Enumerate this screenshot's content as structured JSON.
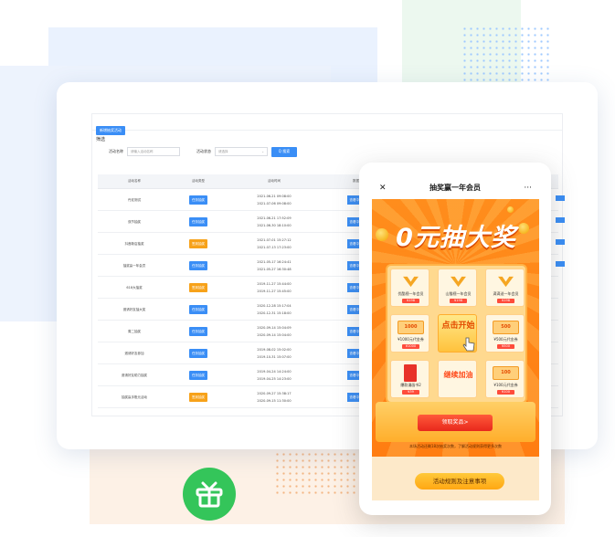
{
  "admin": {
    "create_button": "新增抽奖活动",
    "filter_title": "筛选",
    "filter_name_label": "活动名称",
    "filter_name_placeholder": "请输入活动名称",
    "filter_status_label": "活动状态",
    "filter_status_value": "请选择",
    "search_button": "Q 搜索",
    "columns": [
      "活动名称",
      "活动类型",
      "活动时间",
      "数据统计"
    ],
    "rows": [
      {
        "name": "丹尼测试",
        "type": "任务抽奖",
        "type_color": "blue",
        "start": "2021-06-21 09:08:00",
        "end": "2021-07-06 09:08:00",
        "action": "查看中奖记录"
      },
      {
        "name": "双节抽奖",
        "type": "任务抽奖",
        "type_color": "blue",
        "start": "2021-06-21 17:52:09",
        "end": "2021-06-30 18:10:00",
        "action": "查看中奖记录"
      },
      {
        "name": "抖音新店抽奖",
        "type": "签到抽奖",
        "type_color": "orange",
        "start": "2021-07-01 15:27:12",
        "end": "2021-07-13 17:23:00",
        "action": "查看中奖记录"
      },
      {
        "name": "抽奖赢一年会员",
        "type": "任务抽奖",
        "type_color": "blue",
        "start": "2021-05-17 16:24:41",
        "end": "2021-05-27 16:30:48",
        "action": "查看中奖记录"
      },
      {
        "name": "618大抽奖",
        "type": "签到抽奖",
        "type_color": "orange",
        "start": "2019-11-27 15:44:00",
        "end": "2019-11-27 15:45:00",
        "action": "查看中奖记录"
      },
      {
        "name": "邀请好友抽大奖",
        "type": "任务抽奖",
        "type_color": "blue",
        "start": "2020-12-28 15:17:04",
        "end": "2020-12-31 15:18:00",
        "action": "查看中奖记录"
      },
      {
        "name": "周二抽奖",
        "type": "任务抽奖",
        "type_color": "blue",
        "start": "2020-09-14 15:04:09",
        "end": "2020-09-14 15:04:00",
        "action": "查看中奖记录"
      },
      {
        "name": "邀请好友参加",
        "type": "任务抽奖",
        "type_color": "blue",
        "start": "2019-08-02 15:02:00",
        "end": "2019-10-31 15:07:00",
        "action": "查看中奖记录"
      },
      {
        "name": "邀请好友助力抽奖",
        "type": "任务抽奖",
        "type_color": "blue",
        "start": "2019-04-24 14:24:00",
        "end": "2019-04-25 14:23:00",
        "action": "查看中奖记录"
      },
      {
        "name": "抽奖赢手账元活动",
        "type": "签到抽奖",
        "type_color": "orange",
        "start": "2020-09-27 15:38:17",
        "end": "2020-09-15 11:30:00",
        "action": "查看中奖记录"
      }
    ]
  },
  "phone": {
    "close_icon": "close-icon",
    "title": "抽奖赢一年会员",
    "more_icon": "more-icon",
    "headline": "0元抽大奖",
    "prizes": [
      {
        "label": "优酷视一年会员",
        "badge": "¥198"
      },
      {
        "label": "山猫视一年会员",
        "badge": "¥198"
      },
      {
        "label": "滴滴送一年会员",
        "badge": "¥198"
      },
      {
        "label": "¥1000元代金券",
        "badge": "¥1000",
        "coupon": "1000"
      },
      {
        "label": "¥500元代金券",
        "badge": "¥500",
        "coupon": "500"
      },
      {
        "label": "爆款漫画书2",
        "badge": "¥39"
      },
      {
        "label": "¥100元代金券",
        "badge": "¥100",
        "coupon": "100"
      }
    ],
    "start_button": "点击开始",
    "again_text": "继续加油",
    "claim_button": "领取奖品>",
    "tip": "本场活动还剩18次抽奖次数，了解活动规则获得更多次数",
    "rules_button": "活动规则及注意事项"
  },
  "colors": {
    "accent": "#3a8ef6",
    "warning": "#f7a21a",
    "green": "#34c55a",
    "orange": "#ff8d1c"
  }
}
